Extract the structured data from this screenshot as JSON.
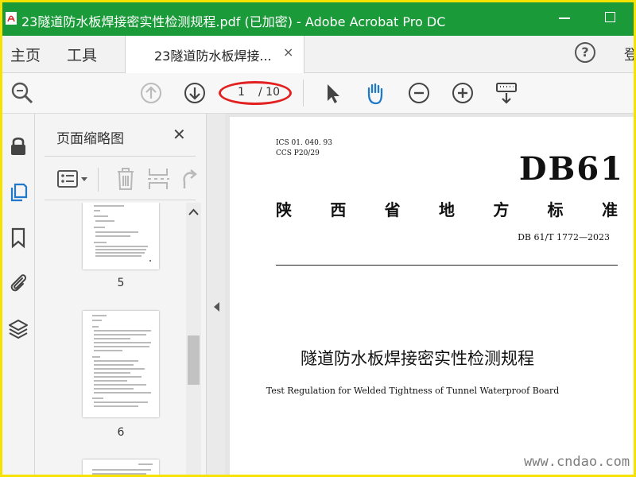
{
  "window": {
    "title": "23隧道防水板焊接密实性检测规程.pdf (已加密) - Adobe Acrobat Pro DC"
  },
  "nav": {
    "home": "主页",
    "tools": "工具",
    "login": "登"
  },
  "tab": {
    "label": "23隧道防水板焊接...",
    "close": "×"
  },
  "help": {
    "label": "?"
  },
  "pager": {
    "current": "1",
    "total": "/ 10"
  },
  "panel": {
    "title": "页面缩略图",
    "close": "✕",
    "thumbs": [
      {
        "num": "5"
      },
      {
        "num": "6"
      }
    ]
  },
  "document": {
    "ics": "ICS   01. 040. 93",
    "ccs": "CCS P20/29",
    "code": "DB61",
    "region_chars": [
      "陕",
      "西",
      "省",
      "地",
      "方",
      "标",
      "准"
    ],
    "std_number": "DB 61/T  1772—2023",
    "title_cn": "隧道防水板焊接密实性检测规程",
    "title_en": "Test Regulation for Welded Tightness of Tunnel Waterproof Board"
  },
  "watermark": "www.cndao.com",
  "colors": {
    "title_bar": "#1a9a39",
    "highlight": "#e2201f",
    "icon_blue": "#1f78c8",
    "frame": "#f5e200"
  }
}
